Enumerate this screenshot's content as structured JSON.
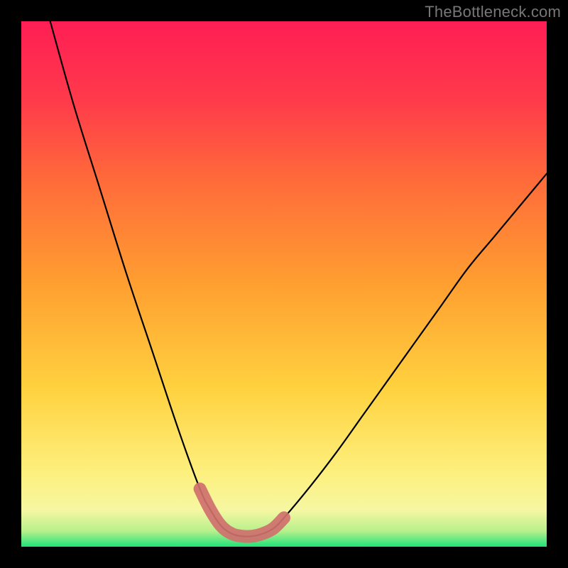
{
  "watermark": "TheBottleneck.com",
  "chart_data": {
    "type": "line",
    "title": "",
    "xlabel": "",
    "ylabel": "",
    "xlim": [
      0,
      1
    ],
    "ylim": [
      0,
      1
    ],
    "grid": false,
    "legend": false,
    "series": [
      {
        "name": "main-curve",
        "color": "#000000",
        "x": [
          0.055,
          0.1,
          0.15,
          0.2,
          0.25,
          0.3,
          0.34,
          0.36,
          0.38,
          0.4,
          0.42,
          0.44,
          0.46,
          0.48,
          0.5,
          0.55,
          0.6,
          0.65,
          0.7,
          0.75,
          0.8,
          0.85,
          0.9,
          0.95,
          1.0
        ],
        "y": [
          1.0,
          0.84,
          0.68,
          0.52,
          0.37,
          0.22,
          0.11,
          0.07,
          0.04,
          0.025,
          0.02,
          0.02,
          0.025,
          0.035,
          0.055,
          0.115,
          0.18,
          0.25,
          0.32,
          0.39,
          0.46,
          0.53,
          0.59,
          0.65,
          0.71
        ]
      },
      {
        "name": "highlight-band",
        "color": "#cf706e",
        "x": [
          0.34,
          0.36,
          0.38,
          0.4,
          0.42,
          0.44,
          0.46,
          0.48,
          0.5
        ],
        "y": [
          0.11,
          0.07,
          0.04,
          0.025,
          0.02,
          0.02,
          0.025,
          0.035,
          0.055
        ]
      }
    ],
    "background_gradient_stops": [
      {
        "y": 0.0,
        "color": "#1fe27a"
      },
      {
        "y": 0.03,
        "color": "#b8f08c"
      },
      {
        "y": 0.07,
        "color": "#f6f7a2"
      },
      {
        "y": 0.14,
        "color": "#fdf07e"
      },
      {
        "y": 0.3,
        "color": "#ffd23f"
      },
      {
        "y": 0.5,
        "color": "#ff9f30"
      },
      {
        "y": 0.7,
        "color": "#ff6a3a"
      },
      {
        "y": 0.85,
        "color": "#ff3a4b"
      },
      {
        "y": 1.0,
        "color": "#ff1e54"
      }
    ]
  }
}
